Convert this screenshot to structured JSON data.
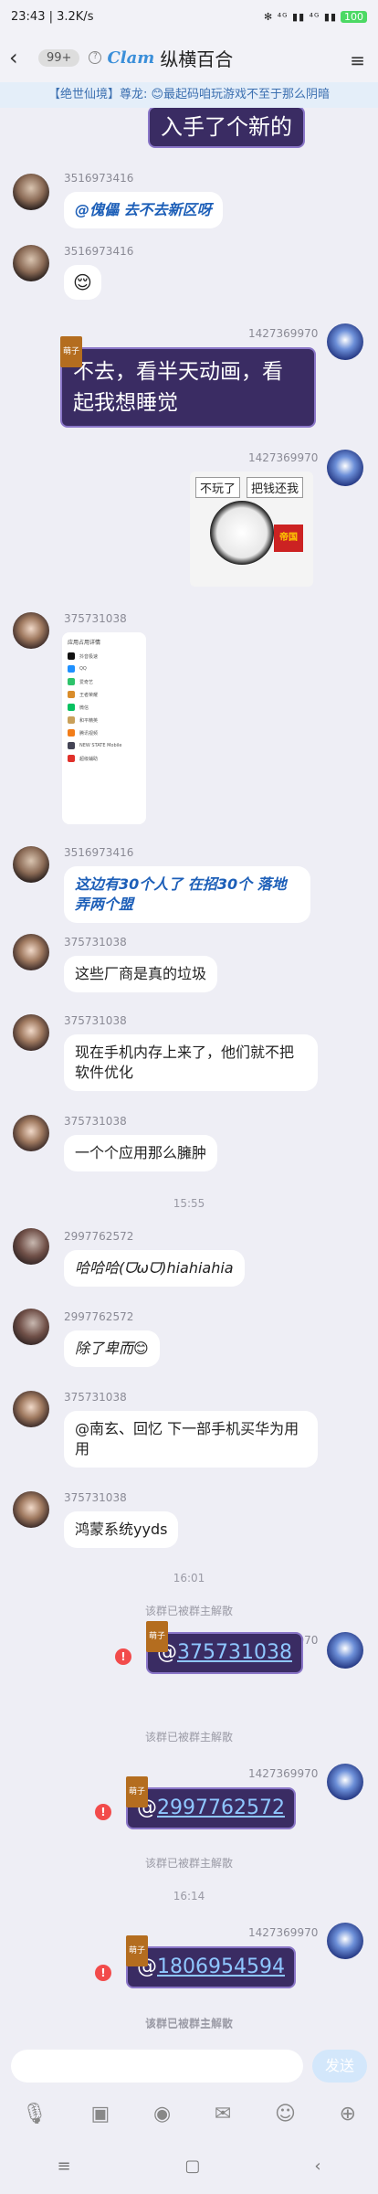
{
  "status": {
    "time_speed": "23:43 | 3.2K/s",
    "right": "✻ ⁴ᴳ ▮▮ ⁴ᴳ ▮▮",
    "battery": "100"
  },
  "header": {
    "back": "‹",
    "unread": "99+",
    "logo": "Clam",
    "title": "纵横百合",
    "menu": "≡"
  },
  "notice": "【绝世仙境】尊龙: 😊最起码咱玩游戏不至于那么阴暗",
  "messages": {
    "m0": {
      "text": "入手了个新的"
    },
    "m1": {
      "nick": "3516973416",
      "text": "@傀儡  去不去新区呀"
    },
    "m2": {
      "nick": "3516973416",
      "text": "😌"
    },
    "m3": {
      "nick": "1427369970",
      "tag": "萌子",
      "text": "不去，看半天动画，看起我想睡觉"
    },
    "m4": {
      "nick": "1427369970",
      "t1": "不玩了",
      "t2": "把钱还我",
      "flag": "帝国"
    },
    "m5": {
      "nick": "375731038",
      "screen_title": "应用占用详情",
      "apps": [
        "抖音极速",
        "QQ",
        "爱奇艺",
        "王者荣耀",
        "微信",
        "和平精英",
        "腾讯视频",
        "NEW STATE Mobile",
        "超级辅助"
      ]
    },
    "m6": {
      "nick": "3516973416",
      "text": "这边有30个人了 在招30个 落地弄两个盟"
    },
    "m7": {
      "nick": "375731038",
      "text": "这些厂商是真的垃圾"
    },
    "m8": {
      "nick": "375731038",
      "text": "现在手机内存上来了，他们就不把软件优化"
    },
    "m9": {
      "nick": "375731038",
      "text": "一个个应用那么臃肿"
    },
    "t1": "15:55",
    "m10": {
      "nick": "2997762572",
      "text": "哈哈哈(ᗜωᗜ)hiahiahia"
    },
    "m11": {
      "nick": "2997762572",
      "text": "除了卑而😊"
    },
    "m12": {
      "nick": "375731038",
      "text": "@南玄、回忆    下一部手机买华为用用"
    },
    "m13": {
      "nick": "375731038",
      "text": "鸿蒙系统yyds"
    },
    "t2": "16:01",
    "s1": "该群已被群主解散",
    "m14": {
      "nick": "1427369970",
      "tag": "萌子",
      "at": "@",
      "link": "375731038"
    },
    "s2": "该群已被群主解散",
    "m15": {
      "nick": "1427369970",
      "tag": "萌子",
      "at": "@",
      "link": "2997762572"
    },
    "s3": "该群已被群主解散",
    "t3": "16:14",
    "m16": {
      "nick": "1427369970",
      "tag": "萌子",
      "at": "@",
      "link": "1806954594"
    },
    "s4": "该群已被群主解散",
    "s5": "该群已被群主解散"
  },
  "input": {
    "send": "发送"
  },
  "toolbar": {
    "mic": "🎙",
    "image": "▣",
    "camera": "◉",
    "redpacket": "✉",
    "emoji": "☺",
    "plus": "⊕"
  },
  "nav": {
    "menu": "≡",
    "home": "▢",
    "back": "‹"
  }
}
